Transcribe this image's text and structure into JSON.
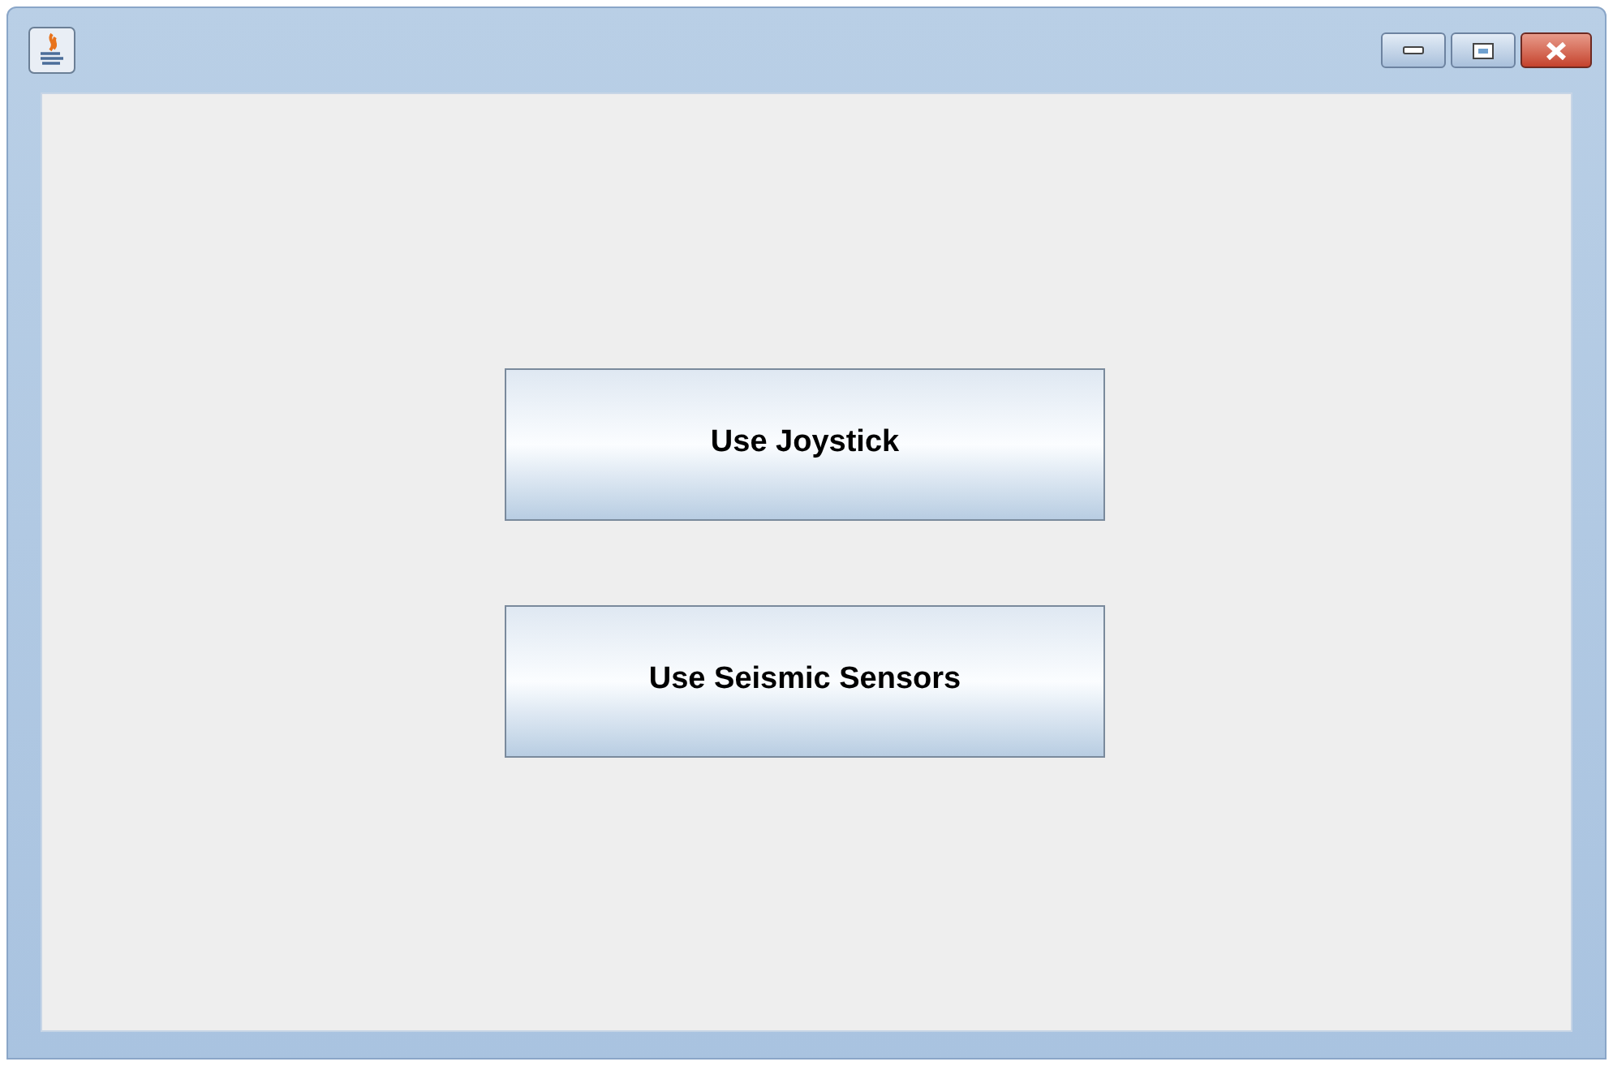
{
  "buttons": [
    {
      "label": "Use Joystick"
    },
    {
      "label": "Use Seismic Sensors"
    }
  ]
}
